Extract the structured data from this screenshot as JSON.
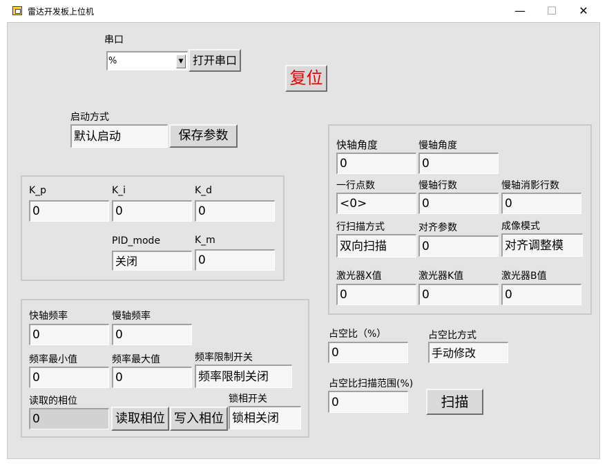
{
  "window": {
    "title": "雷达开发板上位机",
    "minimize_glyph": "—",
    "maximize_glyph": "☐",
    "close_glyph": "✕"
  },
  "serial": {
    "label": "串口",
    "combo_value": "%",
    "open_button": "打开串口"
  },
  "reset_button": "复位",
  "reset_color": "#e60000",
  "startup": {
    "label": "启动方式",
    "value": "默认启动",
    "save_button": "保存参数"
  },
  "pid": {
    "kp_label": "K_p",
    "kp_value": "0",
    "ki_label": "K_i",
    "ki_value": "0",
    "kd_label": "K_d",
    "kd_value": "0",
    "mode_label": "PID_mode",
    "mode_value": "关闭",
    "km_label": "K_m",
    "km_value": "0"
  },
  "freq": {
    "fast_label": "快轴频率",
    "fast_value": "0",
    "slow_label": "慢轴频率",
    "slow_value": "0",
    "min_label": "频率最小值",
    "min_value": "0",
    "max_label": "频率最大值",
    "max_value": "0",
    "limit_label": "频率限制开关",
    "limit_value": "频率限制关闭",
    "phase_read_label": "读取的相位",
    "phase_read_value": "0",
    "read_phase_button": "读取相位",
    "write_phase_button": "写入相位",
    "lock_label": "锁相开关",
    "lock_value": "锁相关闭"
  },
  "scan": {
    "fast_angle_label": "快轴角度",
    "fast_angle_value": "0",
    "slow_angle_label": "慢轴角度",
    "slow_angle_value": "0",
    "line_points_label": "一行点数",
    "line_points_value": "<0>",
    "slow_lines_label": "慢轴行数",
    "slow_lines_value": "0",
    "slow_blank_label": "慢轴消影行数",
    "slow_blank_value": "0",
    "line_mode_label": "行扫描方式",
    "line_mode_value": "双向扫描",
    "align_label": "对齐参数",
    "align_value": "0",
    "imaging_label": "成像模式",
    "imaging_value": "对齐调整模",
    "laser_x_label": "激光器X值",
    "laser_x_value": "0",
    "laser_k_label": "激光器K值",
    "laser_k_value": "0",
    "laser_b_label": "激光器B值",
    "laser_b_value": "0"
  },
  "duty": {
    "duty_label": "占空比（%）",
    "duty_value": "0",
    "duty_mode_label": "占空比方式",
    "duty_mode_value": "手动修改",
    "range_label": "占空比扫描范围(%)",
    "range_value": "0",
    "scan_button": "扫描"
  }
}
